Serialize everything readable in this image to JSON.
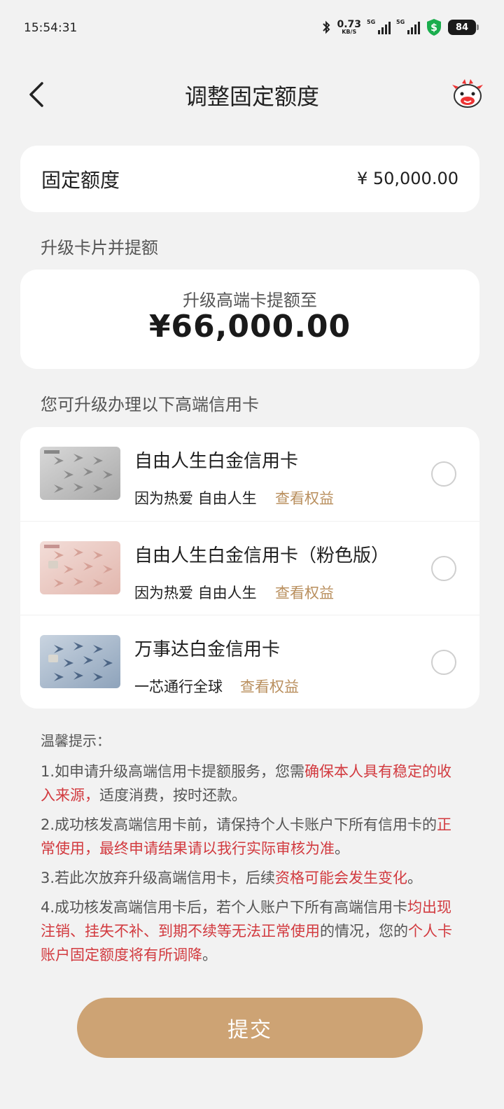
{
  "status_bar": {
    "time": "15:54:31",
    "net_speed_value": "0.73",
    "net_speed_unit": "KB/S",
    "signal_1_label": "5G",
    "signal_2_label": "5G",
    "battery": "84"
  },
  "header": {
    "title": "调整固定额度"
  },
  "fixed_limit": {
    "label": "固定额度",
    "value": "¥ 50,000.00"
  },
  "upgrade": {
    "section_title": "升级卡片并提额",
    "subtitle": "升级高端卡提额至",
    "amount": "¥66,000.00"
  },
  "cards_section_title": "您可升级办理以下高端信用卡",
  "cards": [
    {
      "name": "自由人生白金信用卡",
      "slogan": "因为热爱 自由人生",
      "benefit": "查看权益",
      "selected": false
    },
    {
      "name": "自由人生白金信用卡（粉色版）",
      "slogan": "因为热爱 自由人生",
      "benefit": "查看权益",
      "selected": false
    },
    {
      "name": "万事达白金信用卡",
      "slogan": "一芯通行全球",
      "benefit": "查看权益",
      "selected": false
    }
  ],
  "tips": {
    "title": "温馨提示：",
    "items": [
      {
        "a": "1.如申请升级高端信用卡提额服务，您需",
        "b": "确保本人具有稳定的收入来源，",
        "c": "适度消费，按时还款。"
      },
      {
        "a": "2.成功核发高端信用卡前，请保持个人卡账户下所有信用卡的",
        "b": "正常使用，最终申请结果请以我行实际审核为准",
        "c": "。"
      },
      {
        "a": "3.若此次放弃升级高端信用卡，后续",
        "b": "资格可能会发生变化",
        "c": "。"
      },
      {
        "a": "4.成功核发高端信用卡后，若个人账户下所有高端信用卡",
        "b": "均出现注销、挂失不补、到期不续等无法正常使用",
        "c": "的情况，您的",
        "d": "个人卡账户固定额度将有所调降",
        "e": "。"
      }
    ]
  },
  "submit_label": "提交",
  "colors": {
    "accent": "#cda374",
    "benefit_link": "#b98f5e",
    "warning_red": "#d23a3f",
    "background": "#f2f2f2"
  }
}
